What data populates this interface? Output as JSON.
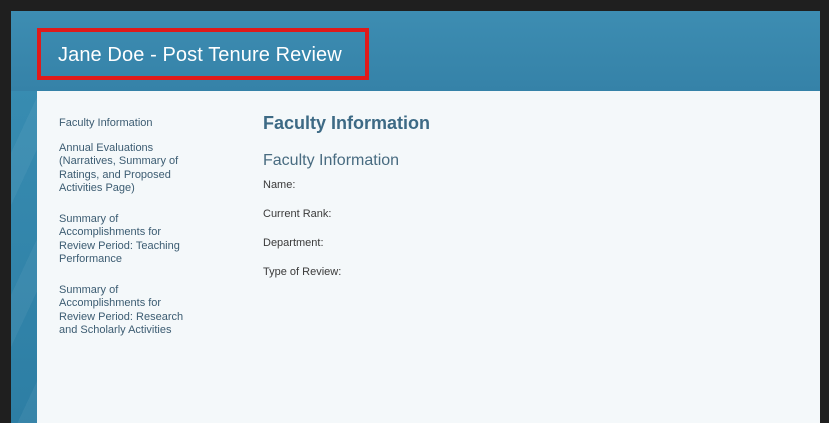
{
  "header": {
    "title": "Jane Doe - Post Tenure Review"
  },
  "sidebar": {
    "items": [
      {
        "label": "Faculty Information"
      },
      {
        "label": "Annual Evaluations (Narratives, Summary of Ratings, and Proposed Activities Page)"
      },
      {
        "label": "Summary of Accomplishments for Review Period: Teaching Performance"
      },
      {
        "label": "Summary of Accomplishments for Review Period: Research and Scholarly Activities"
      }
    ]
  },
  "main": {
    "heading": "Faculty Information",
    "section_title": "Faculty Information",
    "fields": [
      {
        "label": "Name:"
      },
      {
        "label": "Current Rank:"
      },
      {
        "label": "Department:"
      },
      {
        "label": "Type of Review:"
      }
    ]
  },
  "colors": {
    "header_bg": "#3582a8",
    "highlight_border": "#e01a1a",
    "panel_bg": "#f4f8fa",
    "heading_text": "#3d6a85"
  }
}
